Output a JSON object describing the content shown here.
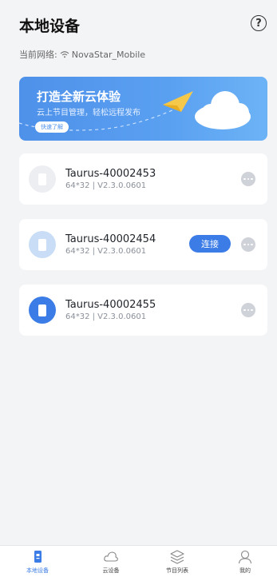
{
  "header": {
    "title": "本地设备",
    "help_icon": "question-circle-icon",
    "help_glyph": "?",
    "network_label": "当前网络:",
    "network_name": "NovaStar_Mobile",
    "network_icon": "wifi-icon"
  },
  "banner": {
    "title": "打造全新云体验",
    "subtitle": "云上节目管理，轻松远程发布",
    "button_label": "快速了解",
    "art_icons": [
      "paper-plane-icon",
      "cloud-icon"
    ]
  },
  "devices": [
    {
      "name": "Taurus-40002453",
      "spec": "64*32 | V2.3.0.0601",
      "status": "offline",
      "show_connect": false
    },
    {
      "name": "Taurus-40002454",
      "spec": "64*32 | V2.3.0.0601",
      "status": "available",
      "show_connect": true,
      "connect_label": "连接"
    },
    {
      "name": "Taurus-40002455",
      "spec": "64*32 | V2.3.0.0601",
      "status": "connected",
      "show_connect": false
    }
  ],
  "tabs": [
    {
      "label": "本地设备",
      "icon": "device-icon",
      "active": true
    },
    {
      "label": "云设备",
      "icon": "cloud-icon",
      "active": false
    },
    {
      "label": "节目列表",
      "icon": "layers-icon",
      "active": false
    },
    {
      "label": "我的",
      "icon": "user-icon",
      "active": false
    }
  ],
  "colors": {
    "accent": "#3b7ce6",
    "banner_start": "#4e91ea",
    "banner_end": "#6cb3f6",
    "icon_offline": "#e6e7ea",
    "icon_available": "#c9ddf6",
    "icon_connected": "#3b7ce6"
  }
}
